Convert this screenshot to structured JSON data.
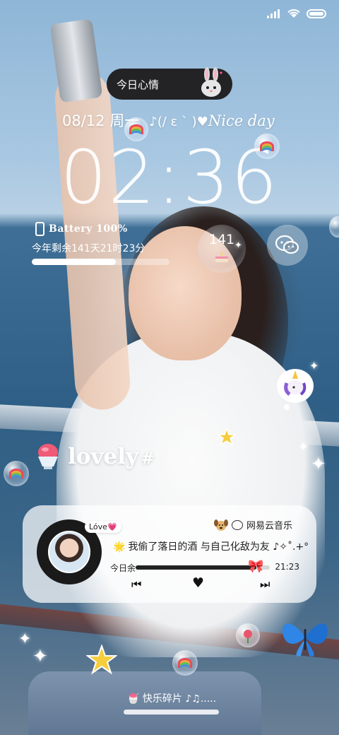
{
  "status_bar": {
    "signal_icon": "signal-icon",
    "wifi_icon": "wifi-icon",
    "battery_icon": "battery-icon"
  },
  "mood_pill": {
    "label": "今日心情",
    "icon": "bunny-icon"
  },
  "date_line": {
    "date": "08/12 周一",
    "kaomoji": "♪(/ ε ` )♥",
    "greeting": "Nice day"
  },
  "clock": {
    "time": "02:36"
  },
  "battery_widget": {
    "label": "Battery 100%",
    "remaining_text": "今年剩余141天21时23分",
    "year_progress_percent": 61
  },
  "days_badge": {
    "number": "141",
    "icon": "birthday-cake-icon"
  },
  "wechat": {
    "icon": "wechat-icon"
  },
  "sticker_text": {
    "word": "lovely",
    "suffix": "#"
  },
  "music_card": {
    "tag": "Lóve💗",
    "source": "网易云音乐",
    "lyric_prefix": "🌟",
    "lyric": "我偷了落日的酒 与自己化敌为友 ♪✧˚.+°",
    "time_left_label": "今日余",
    "time_right": "21:23",
    "progress_fraction": 0.9,
    "controls": {
      "prev": "⏮",
      "like": "♥",
      "next": "⏭"
    }
  },
  "dock": {
    "label": "🍧 快乐碎片 ♪♫.....",
    "icon": "shaved-ice-icon"
  },
  "colors": {
    "mood_bg": "#232326",
    "card_bg": "rgba(255,255,255,0.72)",
    "accent_pink": "#e85d8a"
  }
}
